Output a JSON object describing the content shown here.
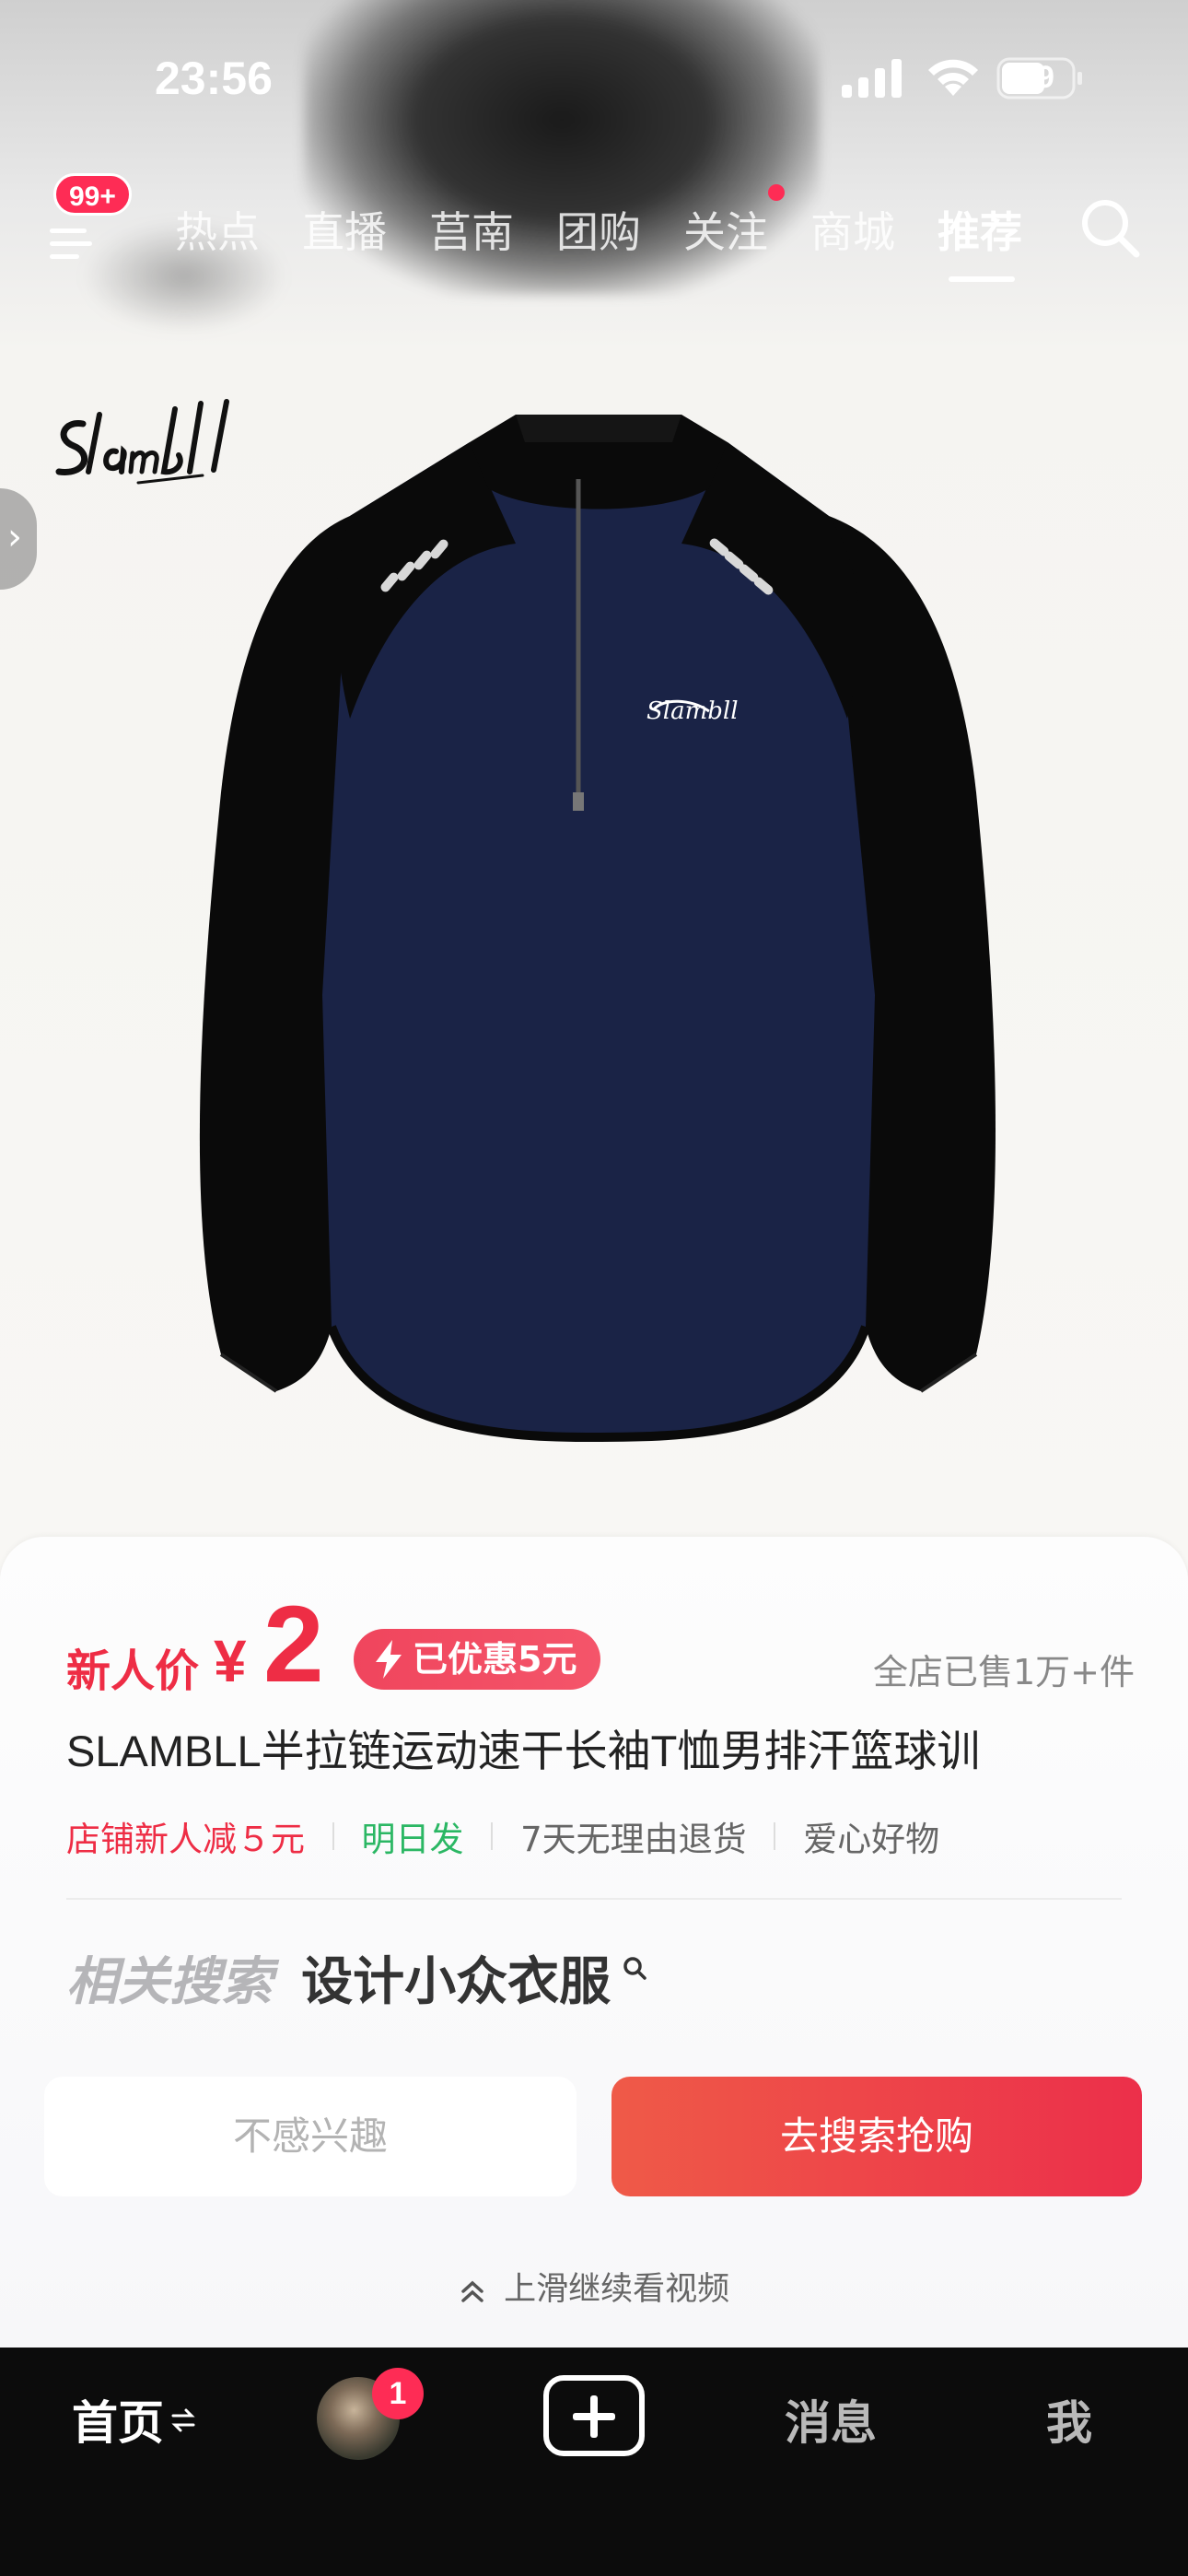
{
  "status_bar": {
    "time": "23:56",
    "battery": "59"
  },
  "nav": {
    "badge": "99+",
    "tabs": [
      {
        "label": "热点"
      },
      {
        "label": "直播"
      },
      {
        "label": "莒南"
      },
      {
        "label": "团购"
      },
      {
        "label": "关注"
      },
      {
        "label": "商城"
      },
      {
        "label": "推荐"
      }
    ],
    "active_tab": "推荐"
  },
  "product": {
    "brand_logo_text": "Slambll",
    "price_label": "新人价",
    "price_symbol": "¥",
    "price_value": "2",
    "discount_badge": "已优惠5元",
    "sold": "全店已售1万+件",
    "title": "SLAMBLL半拉链运动速干长袖T恤男排汗篮球训",
    "tags": {
      "shop_discount": "店铺新人减５元",
      "ship": "明日发",
      "returns": "7天无理由退货",
      "charity": "爱心好物"
    }
  },
  "related": {
    "label": "相关搜索",
    "keyword": "设计小众衣服"
  },
  "actions": {
    "not_interested": "不感兴趣",
    "go_search": "去搜索抢购"
  },
  "swipe_hint": "上滑继续看视频",
  "bottom_bar": {
    "home": "首页",
    "avatar_badge": "1",
    "messages": "消息",
    "me": "我"
  },
  "colors": {
    "accent_red": "#ee2d45",
    "badge_red": "#fe2c55",
    "green": "#2bb764",
    "bottom_bar_bg": "#0c0c0c"
  }
}
